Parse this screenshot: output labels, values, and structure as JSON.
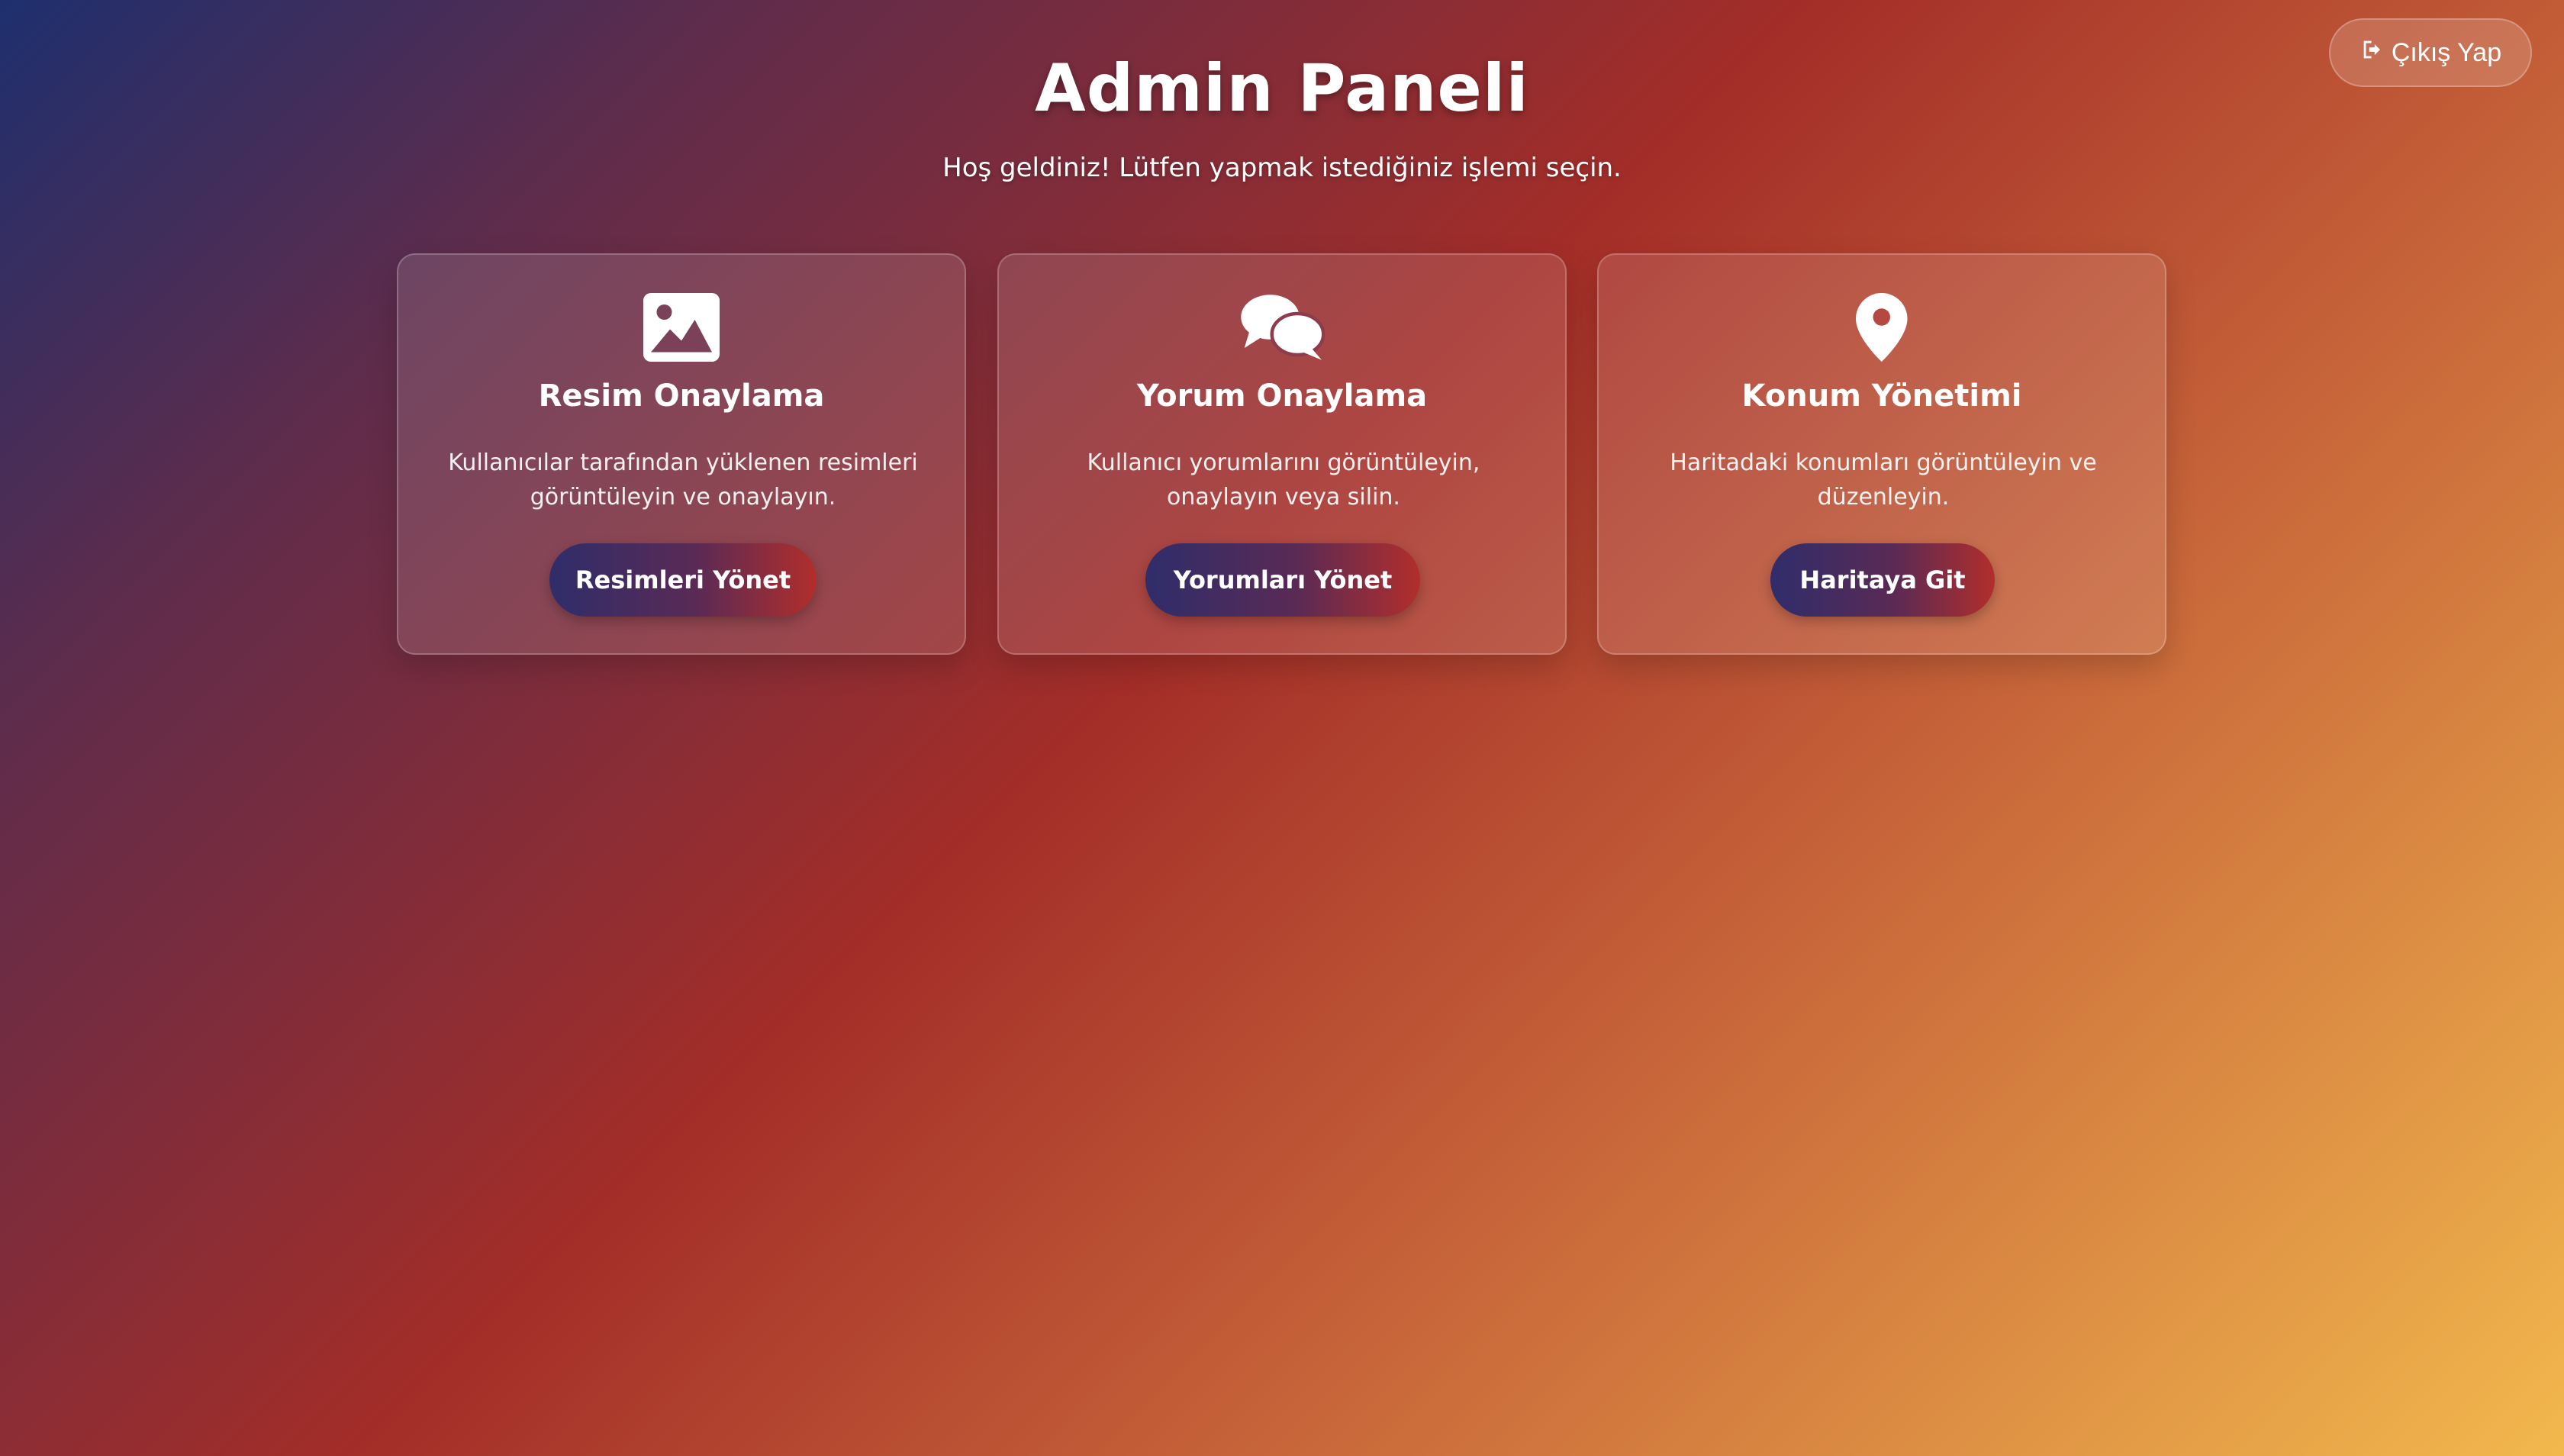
{
  "header": {
    "title": "Admin Paneli",
    "subtitle": "Hoş geldiniz! Lütfen yapmak istediğiniz işlemi seçin.",
    "logout_label": "Çıkış Yap"
  },
  "cards": [
    {
      "icon": "image-icon",
      "title": "Resim Onaylama",
      "description": "Kullanıcılar tarafından yüklenen resimleri görüntüleyin ve onaylayın.",
      "button_label": "Resimleri Yönet"
    },
    {
      "icon": "comments-icon",
      "title": "Yorum Onaylama",
      "description": "Kullanıcı yorumlarını görüntüleyin, onaylayın veya silin.",
      "button_label": "Yorumları Yönet"
    },
    {
      "icon": "map-marker-icon",
      "title": "Konum Yönetimi",
      "description": "Haritadaki konumları görüntüleyin ve düzenleyin.",
      "button_label": "Haritaya Git"
    }
  ],
  "colors": {
    "gradient_start": "#1e2f6e",
    "gradient_mid": "#a32d28",
    "gradient_end": "#f2b84d",
    "button_start": "#2f2d6a",
    "button_end": "#b12e2b"
  }
}
